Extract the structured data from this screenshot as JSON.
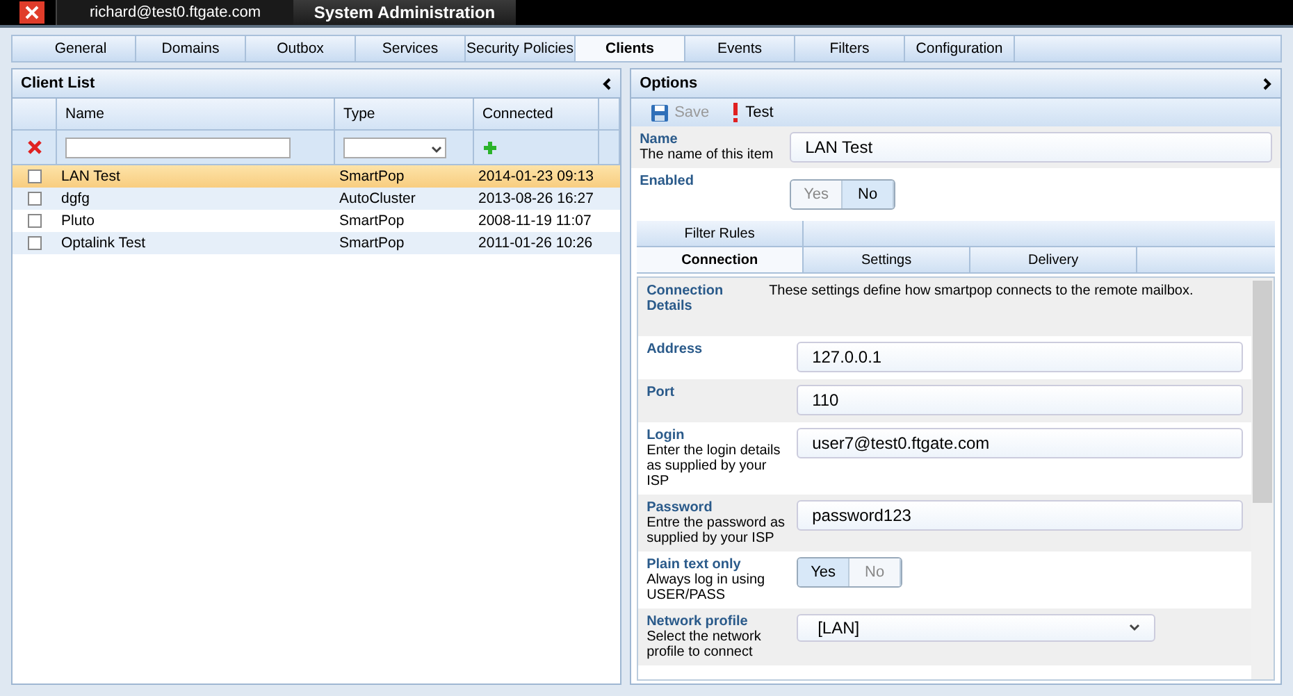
{
  "title_bar": {
    "user": "richard@test0.ftgate.com",
    "title": "System Administration"
  },
  "tabs": [
    {
      "label": "General",
      "selected": false
    },
    {
      "label": "Domains",
      "selected": false
    },
    {
      "label": "Outbox",
      "selected": false
    },
    {
      "label": "Services",
      "selected": false
    },
    {
      "label": "Security Policies",
      "selected": false
    },
    {
      "label": "Clients",
      "selected": true
    },
    {
      "label": "Events",
      "selected": false
    },
    {
      "label": "Filters",
      "selected": false
    },
    {
      "label": "Configuration",
      "selected": false
    }
  ],
  "client_list": {
    "title": "Client List",
    "columns": [
      "Name",
      "Type",
      "Connected"
    ],
    "rows": [
      {
        "name": "LAN Test",
        "type": "SmartPop",
        "connected": "2014-01-23 09:13",
        "selected": true,
        "checked": false
      },
      {
        "name": "dgfg",
        "type": "AutoCluster",
        "connected": "2013-08-26 16:27",
        "selected": false,
        "checked": false
      },
      {
        "name": "Pluto",
        "type": "SmartPop",
        "connected": "2008-11-19 11:07",
        "selected": false,
        "checked": false
      },
      {
        "name": "Optalink Test",
        "type": "SmartPop",
        "connected": "2011-01-26 10:26",
        "selected": false,
        "checked": false
      }
    ]
  },
  "options": {
    "title": "Options",
    "toolbar": [
      {
        "label": "Save",
        "disabled": true
      },
      {
        "label": "Test",
        "disabled": false
      }
    ],
    "name": {
      "label": "Name",
      "hint": "The name of this item",
      "value": "LAN Test"
    },
    "enabled": {
      "label": "Enabled",
      "yes": "Yes",
      "no": "No",
      "on": false
    },
    "subtabs_top": [
      {
        "label": "Filter Rules",
        "selected": false
      }
    ],
    "subtabs": [
      {
        "label": "Connection",
        "selected": true
      },
      {
        "label": "Settings",
        "selected": false
      },
      {
        "label": "Delivery",
        "selected": false
      }
    ],
    "fields": [
      {
        "kind": "heading",
        "label": "Connection Details",
        "hint": "These settings define how smartpop connects to the remote mailbox."
      },
      {
        "kind": "text",
        "label": "Address",
        "value": "127.0.0.1"
      },
      {
        "kind": "text",
        "label": "Port",
        "value": "110"
      },
      {
        "kind": "text",
        "label": "Login",
        "hint": "Enter the login details as supplied by your ISP",
        "value": "user7@test0.ftgate.com"
      },
      {
        "kind": "text",
        "label": "Password",
        "hint": "Entre the password as supplied by your ISP",
        "value": "password123"
      },
      {
        "kind": "toggle",
        "label": "Plain text only",
        "hint": "Always log in using USER/PASS",
        "yes": "Yes",
        "no": "No",
        "on": true
      },
      {
        "kind": "select",
        "label": "Network profile",
        "hint": "Select the network profile to connect",
        "value": "[LAN]"
      }
    ]
  }
}
